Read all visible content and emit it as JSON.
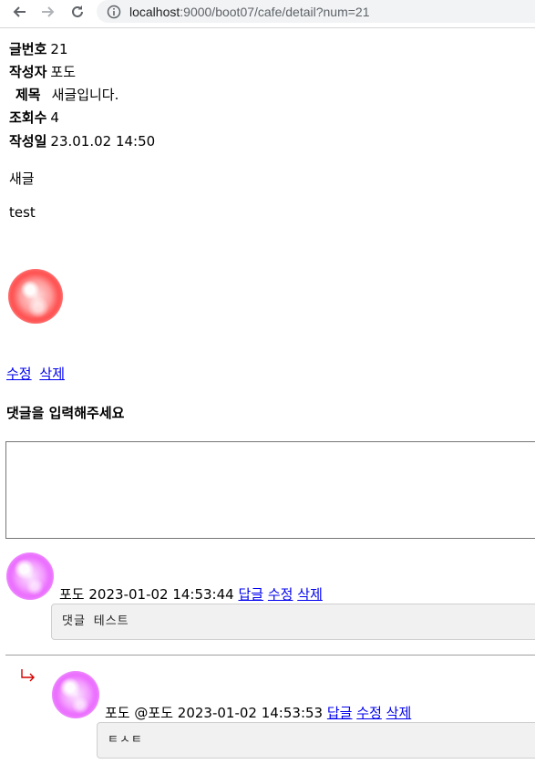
{
  "browser": {
    "url_host": "localhost",
    "url_rest": ":9000/boot07/cafe/detail?num=21"
  },
  "post": {
    "num_label": "글번호",
    "num_value": "21",
    "writer_label": "작성자",
    "writer_value": "포도",
    "title_label": "제목",
    "title_value": "새글입니다.",
    "views_label": "조회수",
    "views_value": "4",
    "date_label": "작성일",
    "date_value": "23.01.02 14:50",
    "body_line1": "새글",
    "body_line2": "test"
  },
  "actions": {
    "edit_label": "수정",
    "delete_label": "삭제"
  },
  "comment_form": {
    "heading": "댓글을 입력해주세요",
    "value": ""
  },
  "comments": [
    {
      "writer": "포도",
      "target": "",
      "date": "2023-01-02 14:53:44",
      "reply_label": "답글",
      "edit_label": "수정",
      "delete_label": "삭제",
      "content": "댓글 테스트"
    },
    {
      "writer": "포도",
      "target": "@포도",
      "date": "2023-01-02 14:53:53",
      "reply_label": "답글",
      "edit_label": "수정",
      "delete_label": "삭제",
      "content": "ㅌㅅㅌ"
    }
  ],
  "colors": {
    "link": "#0000ee",
    "reply_arrow": "#d40000",
    "profile_post": "#ff2a2a",
    "profile_comment": "#e64dff"
  },
  "icons": [
    "back-arrow-icon",
    "forward-arrow-icon",
    "reload-icon",
    "info-icon",
    "reply-arrow-icon"
  ]
}
